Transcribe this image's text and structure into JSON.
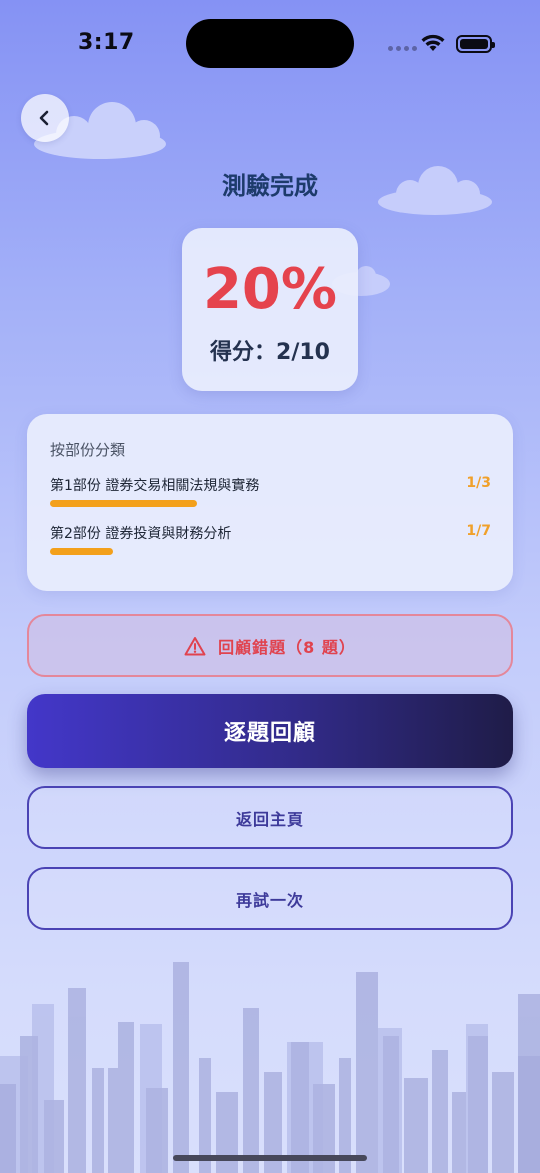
{
  "status_bar": {
    "time": "3:17"
  },
  "header": {
    "title": "測驗完成"
  },
  "icons": {
    "back": "chevron-left-icon",
    "warning": "warning-triangle-icon"
  },
  "score": {
    "percent": "20%",
    "text": "得分：2/10",
    "fraction": 0.2
  },
  "sections": {
    "heading": "按部份分類",
    "items": [
      {
        "name": "第1部份 證券交易相關法規與實務",
        "score": "1/3",
        "progress": 0.333
      },
      {
        "name": "第2部份 證券投資與財務分析",
        "score": "1/7",
        "progress": 0.143
      }
    ]
  },
  "actions": {
    "review_wrong": "回顧錯題（8 題）",
    "review_each": "逐題回顧",
    "back_home": "返回主頁",
    "retry": "再試一次"
  },
  "colors": {
    "accent_red": "#e5434d",
    "progress_orange": "#f3a01b",
    "primary_indigo": "#4337c9",
    "title_navy": "#1d3b6b"
  }
}
